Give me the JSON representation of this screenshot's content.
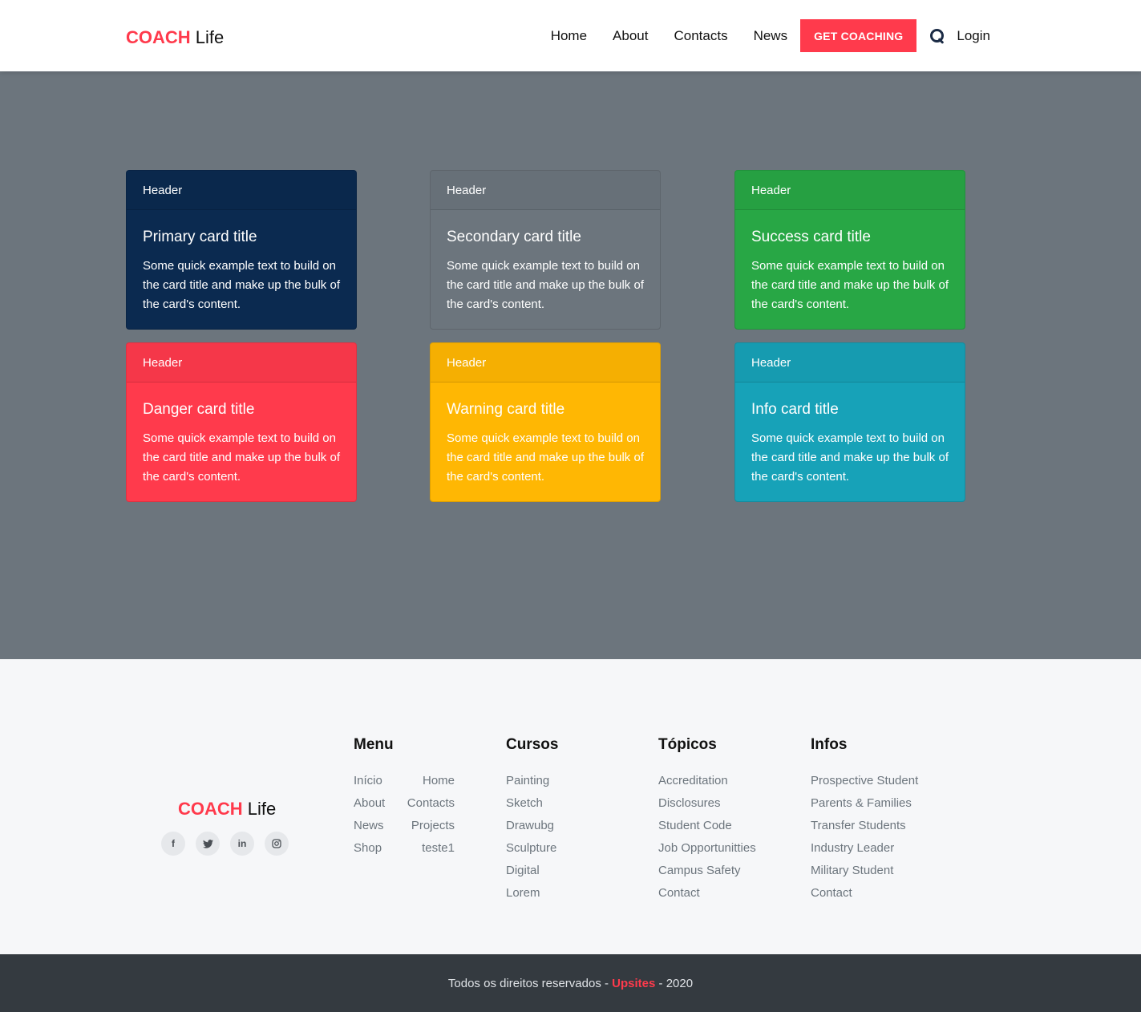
{
  "navbar": {
    "brand_primary": "COACH",
    "brand_secondary": "Life",
    "links": [
      "Home",
      "About",
      "Contacts",
      "News"
    ],
    "cta_label": "GET COACHING",
    "login_label": "Login"
  },
  "cards": [
    {
      "header": "Header",
      "title": "Primary card title",
      "text": "Some quick example text to build on the card title and make up the bulk of the card's content.",
      "color": "#0b2a50"
    },
    {
      "header": "Header",
      "title": "Secondary card title",
      "text": "Some quick example text to build on the card title and make up the bulk of the card's content.",
      "color": "#6c757d"
    },
    {
      "header": "Header",
      "title": "Success card title",
      "text": "Some quick example text to build on the card title and make up the bulk of the card's content.",
      "color": "#28a745"
    },
    {
      "header": "Header",
      "title": "Danger card title",
      "text": "Some quick example text to build on the card title and make up the bulk of the card's content.",
      "color": "#ff3a4c"
    },
    {
      "header": "Header",
      "title": "Warning card title",
      "text": "Some quick example text to build on the card title and make up the bulk of the card's content.",
      "color": "#ffb703"
    },
    {
      "header": "Header",
      "title": "Info card title",
      "text": "Some quick example text to build on the card title and make up the bulk of the card's content.",
      "color": "#17a2b8"
    }
  ],
  "footer": {
    "brand_primary": "COACH",
    "brand_secondary": "Life",
    "socials": [
      "facebook-icon",
      "twitter-icon",
      "linkedin-icon",
      "instagram-icon"
    ],
    "menu": {
      "title": "Menu",
      "left": [
        "Início",
        "About",
        "News",
        "Shop"
      ],
      "right": [
        "Home",
        "Contacts",
        "Projects",
        "teste1"
      ]
    },
    "cursos": {
      "title": "Cursos",
      "items": [
        "Painting",
        "Sketch",
        "Drawubg",
        "Sculpture",
        "Digital",
        "Lorem"
      ]
    },
    "topicos": {
      "title": "Tópicos",
      "items": [
        "Accreditation",
        "Disclosures",
        "Student Code",
        "Job Opportunitties",
        "Campus Safety",
        "Contact"
      ]
    },
    "infos": {
      "title": "Infos",
      "items": [
        "Prospective Student",
        "Parents & Families",
        "Transfer Students",
        "Industry Leader",
        "Military Student",
        "Contact"
      ]
    }
  },
  "copyright": {
    "prefix": "Todos os direitos reservados -",
    "highlight": "Upsites",
    "suffix": "- 2020"
  },
  "colors": {
    "accent": "#ff3a4c",
    "hero_bg": "#6c757d",
    "footer_bottom": "#343a40"
  }
}
